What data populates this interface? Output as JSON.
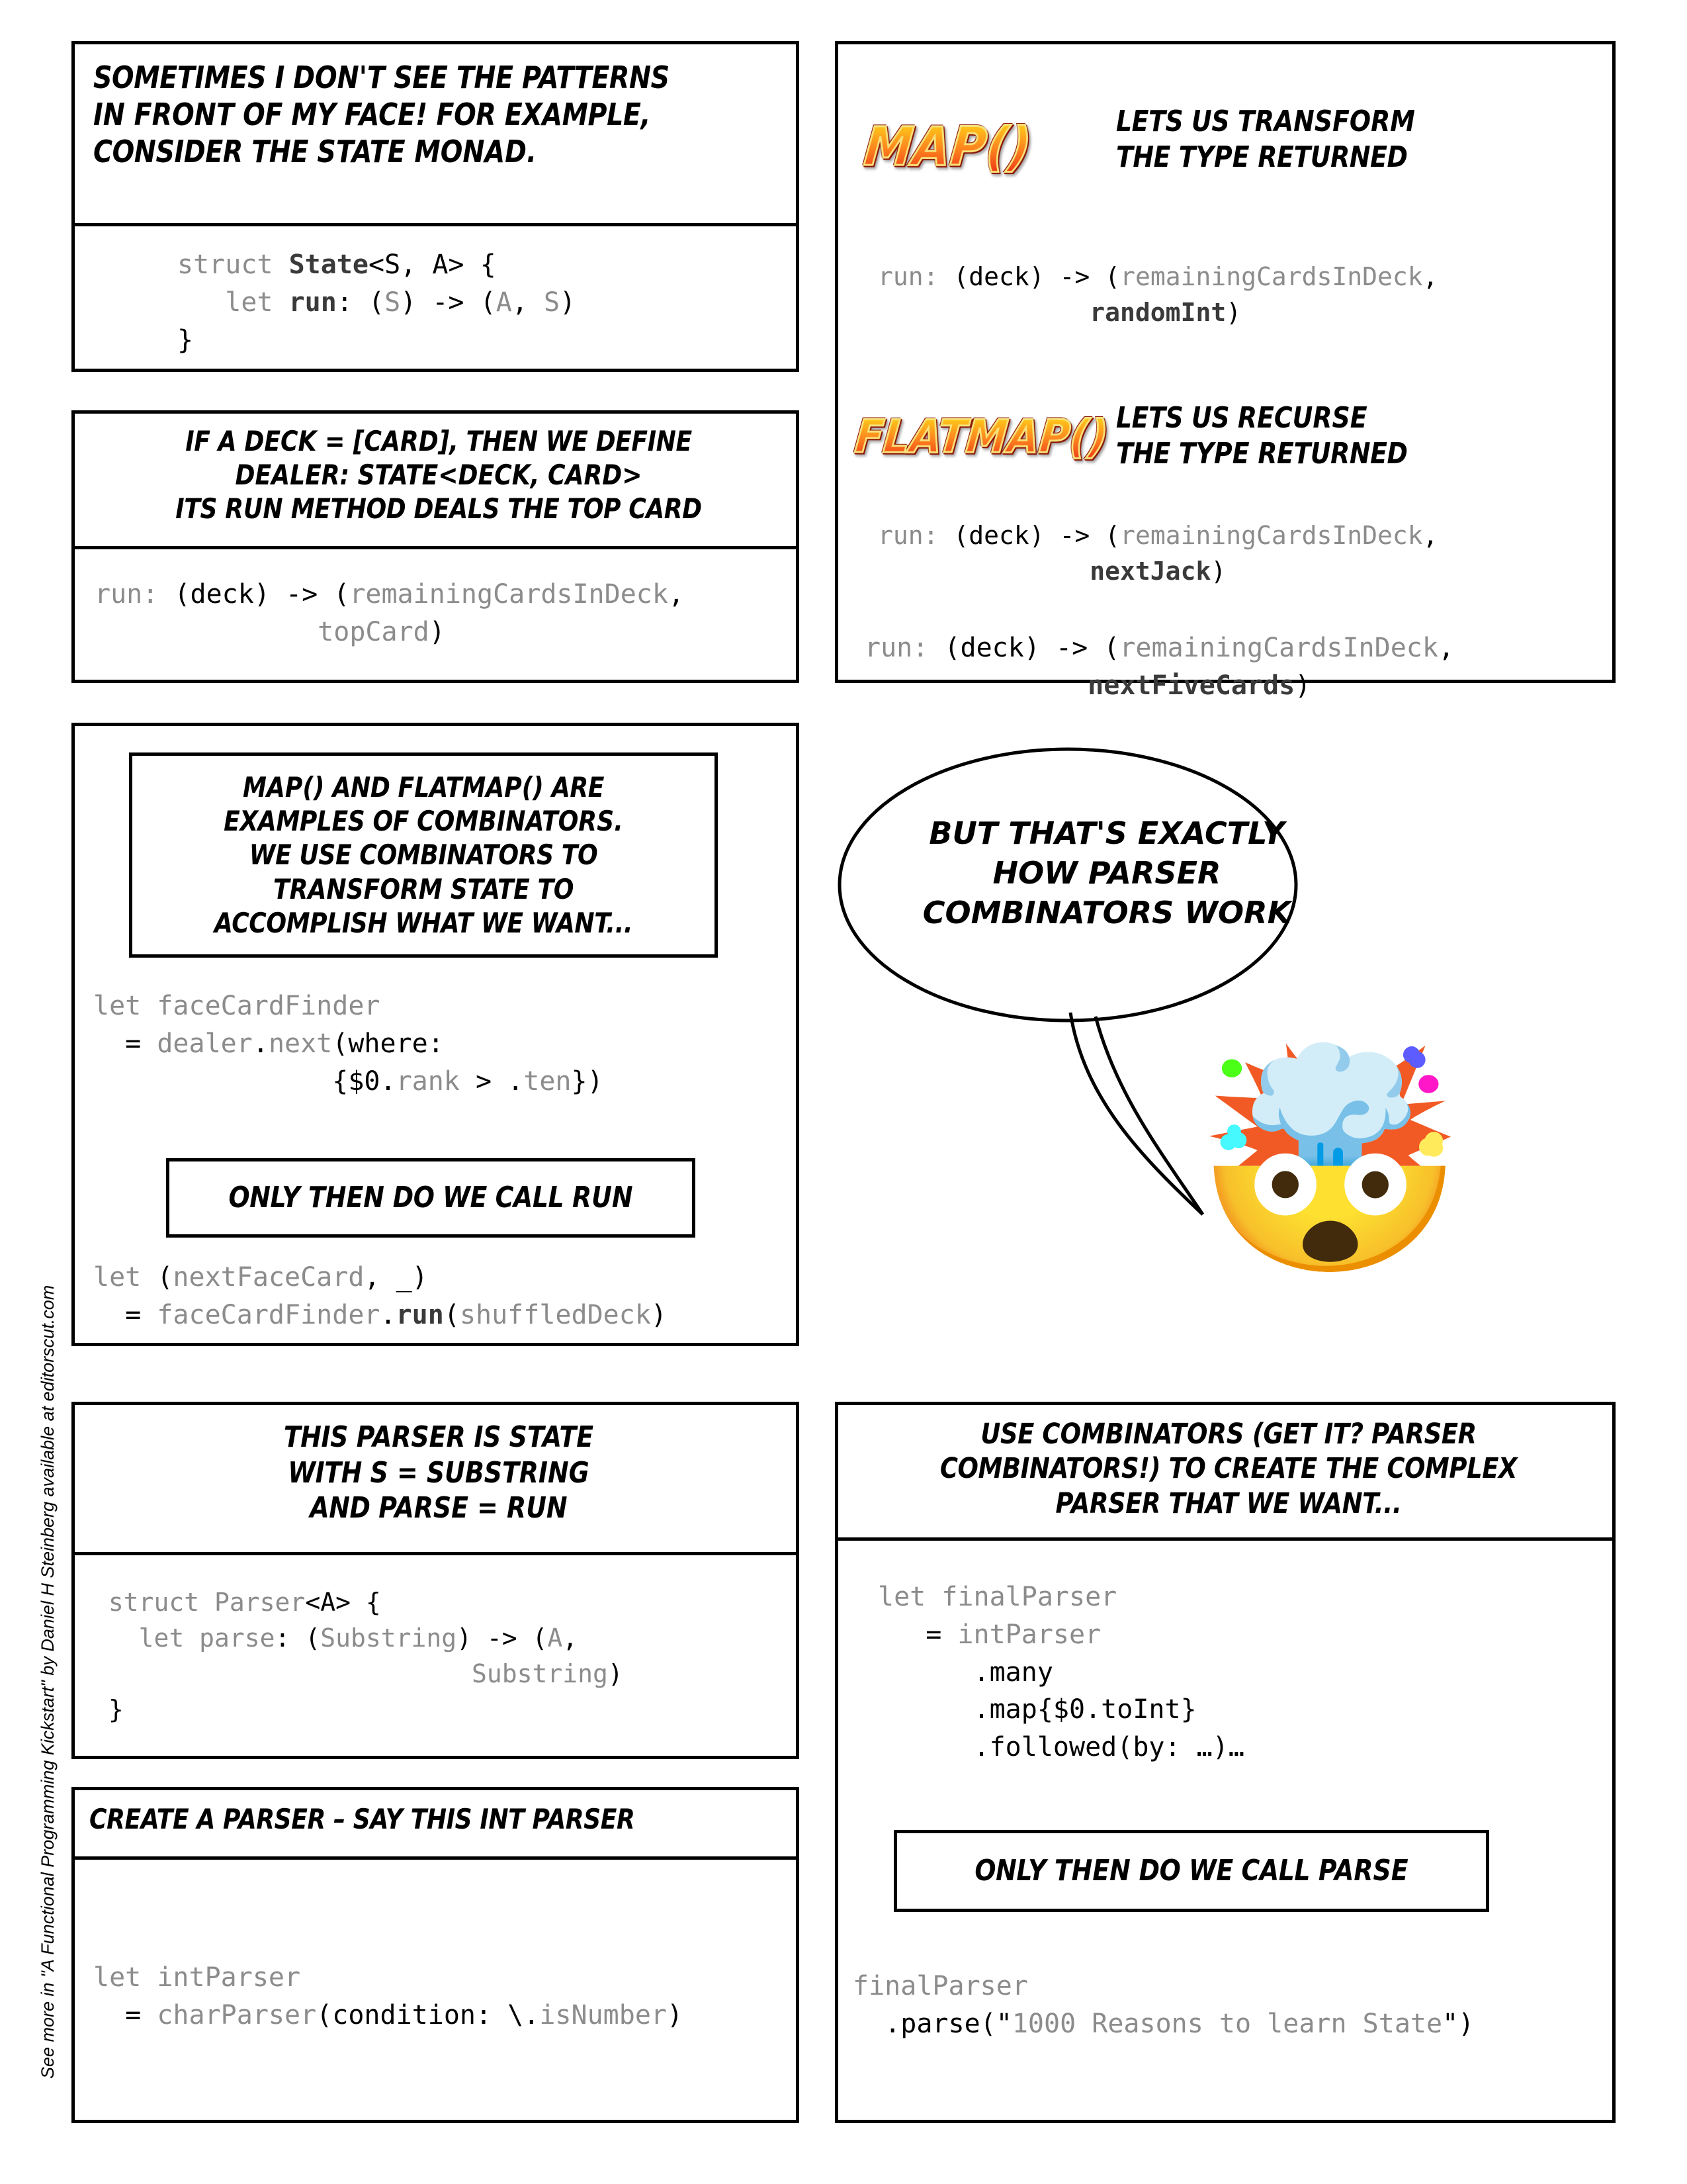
{
  "credit": "See more in  \"A Functional Programming Kickstart\" by Daniel H Steinberg available at editorscut.com",
  "colors": {
    "ink": "#000000",
    "code_dim": "#8c8c8c",
    "code_mid": "#3a3a3a",
    "logo_top": "#ffe14d",
    "logo_bottom": "#e8230f",
    "logo_outline": "#8a1206",
    "logo_rim": "#f6e27a"
  },
  "panels": {
    "intro": {
      "caption_lines": [
        [
          {
            "t": "Sometimes I ",
            "b": false
          },
          {
            "t": "don't",
            "b": true
          },
          {
            "t": " see the patterns",
            "b": false
          }
        ],
        [
          {
            "t": "in front",
            "b": true
          },
          {
            "t": " of my ",
            "b": false
          },
          {
            "t": "face!",
            "b": true
          },
          {
            "t": " For example,",
            "b": false
          }
        ],
        [
          {
            "t": "consider the ",
            "b": false
          },
          {
            "t": "State Monad.",
            "b": true
          }
        ]
      ],
      "code_lines": [
        [
          {
            "t": "struct ",
            "s": "dim"
          },
          {
            "t": "State",
            "s": "bold"
          },
          {
            "t": "<S, A> {",
            "s": "black"
          }
        ],
        [
          {
            "t": "   let ",
            "s": "dim"
          },
          {
            "t": "run",
            "s": "bold"
          },
          {
            "t": ": ",
            "s": "black"
          },
          {
            "t": "(",
            "s": "black"
          },
          {
            "t": "S",
            "s": "dim"
          },
          {
            "t": ") -> (",
            "s": "black"
          },
          {
            "t": "A",
            "s": "dim"
          },
          {
            "t": ", ",
            "s": "black"
          },
          {
            "t": "S",
            "s": "dim"
          },
          {
            "t": ")",
            "s": "black"
          }
        ],
        [
          {
            "t": "}",
            "s": "black"
          }
        ]
      ]
    },
    "dealer": {
      "caption_lines": [
        [
          {
            "t": "If a ",
            "b": false
          },
          {
            "t": "deck = [Card]",
            "b": true
          },
          {
            "t": ", then we define",
            "b": false
          }
        ],
        [
          {
            "t": "dealer: State<Deck, Card>",
            "b": true
          }
        ],
        [
          {
            "t": "its ",
            "b": false
          },
          {
            "t": "run",
            "b": true
          },
          {
            "t": " method deals the top card",
            "b": false
          }
        ]
      ],
      "code_lines": [
        [
          {
            "t": "run: ",
            "s": "dim"
          },
          {
            "t": "(deck) -> (",
            "s": "black"
          },
          {
            "t": "remainingCardsInDeck",
            "s": "dim"
          },
          {
            "t": ",",
            "s": "black"
          }
        ],
        [
          {
            "t": "              ",
            "s": "dim"
          },
          {
            "t": "topCard",
            "s": "dim"
          },
          {
            "t": ")",
            "s": "black"
          }
        ]
      ]
    },
    "map_flatmap": {
      "map_logo": "MAP()",
      "map_caption_lines": [
        [
          {
            "t": "Lets us ",
            "b": false
          },
          {
            "t": "transform",
            "b": true
          }
        ],
        [
          {
            "t": "the ",
            "b": false
          },
          {
            "t": "type",
            "b": true
          },
          {
            "t": " returned",
            "b": false
          }
        ]
      ],
      "map_code_lines": [
        [
          {
            "t": "run: ",
            "s": "dim"
          },
          {
            "t": "(deck) -> (",
            "s": "black"
          },
          {
            "t": "remainingCardsInDeck",
            "s": "dim"
          },
          {
            "t": ",",
            "s": "black"
          }
        ],
        [
          {
            "t": "              ",
            "s": "dim"
          },
          {
            "t": "randomInt",
            "s": "bold"
          },
          {
            "t": ")",
            "s": "black"
          }
        ]
      ],
      "flatmap_logo": "FLATMAP()",
      "flatmap_caption_lines": [
        [
          {
            "t": "Lets us ",
            "b": false
          },
          {
            "t": "recurse",
            "b": true
          }
        ],
        [
          {
            "t": "the ",
            "b": false
          },
          {
            "t": "type",
            "b": true
          },
          {
            "t": " returned",
            "b": false
          }
        ]
      ],
      "flatmap_code_lines_1": [
        [
          {
            "t": "run: ",
            "s": "dim"
          },
          {
            "t": "(deck) -> (",
            "s": "black"
          },
          {
            "t": "remainingCardsInDeck",
            "s": "dim"
          },
          {
            "t": ",",
            "s": "black"
          }
        ],
        [
          {
            "t": "              ",
            "s": "dim"
          },
          {
            "t": "nextJack",
            "s": "bold"
          },
          {
            "t": ")",
            "s": "black"
          }
        ]
      ],
      "flatmap_code_lines_2": [
        [
          {
            "t": "run: ",
            "s": "dim"
          },
          {
            "t": "(deck) -> (",
            "s": "black"
          },
          {
            "t": "remainingCardsInDeck",
            "s": "dim"
          },
          {
            "t": ",",
            "s": "black"
          }
        ],
        [
          {
            "t": "              ",
            "s": "dim"
          },
          {
            "t": "nextFiveCards",
            "s": "bold"
          },
          {
            "t": ")",
            "s": "black"
          }
        ]
      ]
    },
    "combinators": {
      "inner_caption_lines": [
        [
          {
            "t": "map()",
            "b": true
          },
          {
            "t": " and ",
            "b": false
          },
          {
            "t": "flatMap()",
            "b": true
          },
          {
            "t": " are",
            "b": false
          }
        ],
        [
          {
            "t": "examples of ",
            "b": false
          },
          {
            "t": "combinators.",
            "b": true
          }
        ],
        [
          {
            "t": "We use combinators to",
            "b": false
          }
        ],
        [
          {
            "t": "transform",
            "b": true
          },
          {
            "t": " state to",
            "b": false
          }
        ],
        [
          {
            "t": "accomplish what we want...",
            "b": false
          }
        ]
      ],
      "code_lines_1": [
        [
          {
            "t": "let ",
            "s": "dim"
          },
          {
            "t": "faceCardFinder",
            "s": "dim"
          }
        ],
        [
          {
            "t": "  ",
            "s": "dim"
          },
          {
            "t": "= ",
            "s": "black"
          },
          {
            "t": "dealer",
            "s": "dim"
          },
          {
            "t": ".",
            "s": "black"
          },
          {
            "t": "next",
            "s": "dim"
          },
          {
            "t": "(where:",
            "s": "black"
          }
        ],
        [
          {
            "t": "               ",
            "s": "dim"
          },
          {
            "t": "{$0.",
            "s": "black"
          },
          {
            "t": "rank",
            "s": "dim"
          },
          {
            "t": " > ",
            "s": "black"
          },
          {
            "t": ".",
            "s": "black"
          },
          {
            "t": "ten",
            "s": "dim"
          },
          {
            "t": "})",
            "s": "black"
          }
        ]
      ],
      "only_then_line": [
        [
          {
            "t": "Only ",
            "b": false
          },
          {
            "t": "then",
            "b": true
          },
          {
            "t": " do we call ",
            "b": false
          },
          {
            "t": "run",
            "b": true
          }
        ]
      ],
      "code_lines_2": [
        [
          {
            "t": "let ",
            "s": "dim"
          },
          {
            "t": "(",
            "s": "black"
          },
          {
            "t": "nextFaceCard",
            "s": "dim"
          },
          {
            "t": ", ",
            "s": "black"
          },
          {
            "t": "_)",
            "s": "black"
          }
        ],
        [
          {
            "t": "  ",
            "s": "dim"
          },
          {
            "t": "= ",
            "s": "black"
          },
          {
            "t": "faceCardFinder",
            "s": "dim"
          },
          {
            "t": ".",
            "s": "black"
          },
          {
            "t": "run",
            "s": "bold"
          },
          {
            "t": "(",
            "s": "black"
          },
          {
            "t": "shuffledDeck",
            "s": "dim"
          },
          {
            "t": ")",
            "s": "black"
          }
        ]
      ]
    },
    "balloon": {
      "lines": [
        [
          {
            "t": "But that's ",
            "b": false
          },
          {
            "t": "exactly",
            "b": true
          }
        ],
        [
          {
            "t": "how ",
            "b": false
          },
          {
            "t": "Parser",
            "b": true
          }
        ],
        [
          {
            "t": "Combinators",
            "b": true
          },
          {
            "t": " work",
            "b": false
          }
        ]
      ],
      "emoji": "🤯",
      "emoji_name": "exploding-head-emoji"
    },
    "parser_is_state": {
      "caption_lines": [
        [
          {
            "t": "This ",
            "b": false
          },
          {
            "t": "Parser",
            "b": true
          },
          {
            "t": " is ",
            "b": false
          },
          {
            "t": "State",
            "b": true
          }
        ],
        [
          {
            "t": "with ",
            "b": false
          },
          {
            "t": "S = Substring",
            "b": true
          }
        ],
        [
          {
            "t": "and ",
            "b": false
          },
          {
            "t": "parse = run",
            "b": true
          }
        ]
      ],
      "code_lines": [
        [
          {
            "t": " struct ",
            "s": "dim"
          },
          {
            "t": "Parser",
            "s": "dim"
          },
          {
            "t": "<A> {",
            "s": "black"
          }
        ],
        [
          {
            "t": "   let ",
            "s": "dim"
          },
          {
            "t": "parse",
            "s": "dim"
          },
          {
            "t": ": (",
            "s": "black"
          },
          {
            "t": "Substring",
            "s": "dim"
          },
          {
            "t": ") -> (",
            "s": "black"
          },
          {
            "t": "A",
            "s": "dim"
          },
          {
            "t": ",",
            "s": "black"
          }
        ],
        [
          {
            "t": "                         ",
            "s": "dim"
          },
          {
            "t": "Substring",
            "s": "dim"
          },
          {
            "t": ")",
            "s": "black"
          }
        ],
        [
          {
            "t": " }",
            "s": "black"
          }
        ]
      ]
    },
    "create_parser": {
      "caption_lines": [
        [
          {
            "t": "Create a parser – say this int parser",
            "b": false
          }
        ]
      ],
      "code_lines": [
        [
          {
            "t": "let ",
            "s": "dim"
          },
          {
            "t": "intParser",
            "s": "dim"
          }
        ],
        [
          {
            "t": "  ",
            "s": "dim"
          },
          {
            "t": "= ",
            "s": "black"
          },
          {
            "t": "charParser",
            "s": "dim"
          },
          {
            "t": "(condition: \\.",
            "s": "black"
          },
          {
            "t": "isNumber",
            "s": "dim"
          },
          {
            "t": ")",
            "s": "black"
          }
        ]
      ]
    },
    "final_parser": {
      "caption_lines": [
        [
          {
            "t": "Use ",
            "b": false
          },
          {
            "t": "combinators",
            "b": true
          },
          {
            "t": " (get it? Parser",
            "b": false
          }
        ],
        [
          {
            "t": "combinators!) to ",
            "b": false
          },
          {
            "t": "create",
            "b": true
          },
          {
            "t": " the complex",
            "b": false
          }
        ],
        [
          {
            "t": "parser that we want...",
            "b": false
          }
        ]
      ],
      "code_lines_1": [
        [
          {
            "t": "let ",
            "s": "dim"
          },
          {
            "t": "finalParser",
            "s": "dim"
          }
        ],
        [
          {
            "t": "   ",
            "s": "dim"
          },
          {
            "t": "= ",
            "s": "black"
          },
          {
            "t": "intParser",
            "s": "dim"
          }
        ],
        [
          {
            "t": "      ",
            "s": "dim"
          },
          {
            "t": ".many",
            "s": "black"
          }
        ],
        [
          {
            "t": "      ",
            "s": "dim"
          },
          {
            "t": ".map{$0.toInt}",
            "s": "black"
          }
        ],
        [
          {
            "t": "      ",
            "s": "dim"
          },
          {
            "t": ".followed(by: …)…",
            "s": "black"
          }
        ]
      ],
      "only_then_line": [
        [
          {
            "t": "Only ",
            "b": false
          },
          {
            "t": "then",
            "b": true
          },
          {
            "t": " do we call ",
            "b": false
          },
          {
            "t": "parse",
            "b": true
          }
        ]
      ],
      "code_lines_2": [
        [
          {
            "t": "finalParser",
            "s": "dim"
          }
        ],
        [
          {
            "t": "  ",
            "s": "dim"
          },
          {
            "t": ".parse",
            "s": "black"
          },
          {
            "t": "(\"",
            "s": "black"
          },
          {
            "t": "1000 Reasons to learn State",
            "s": "dim"
          },
          {
            "t": "\")",
            "s": "black"
          }
        ]
      ]
    }
  }
}
